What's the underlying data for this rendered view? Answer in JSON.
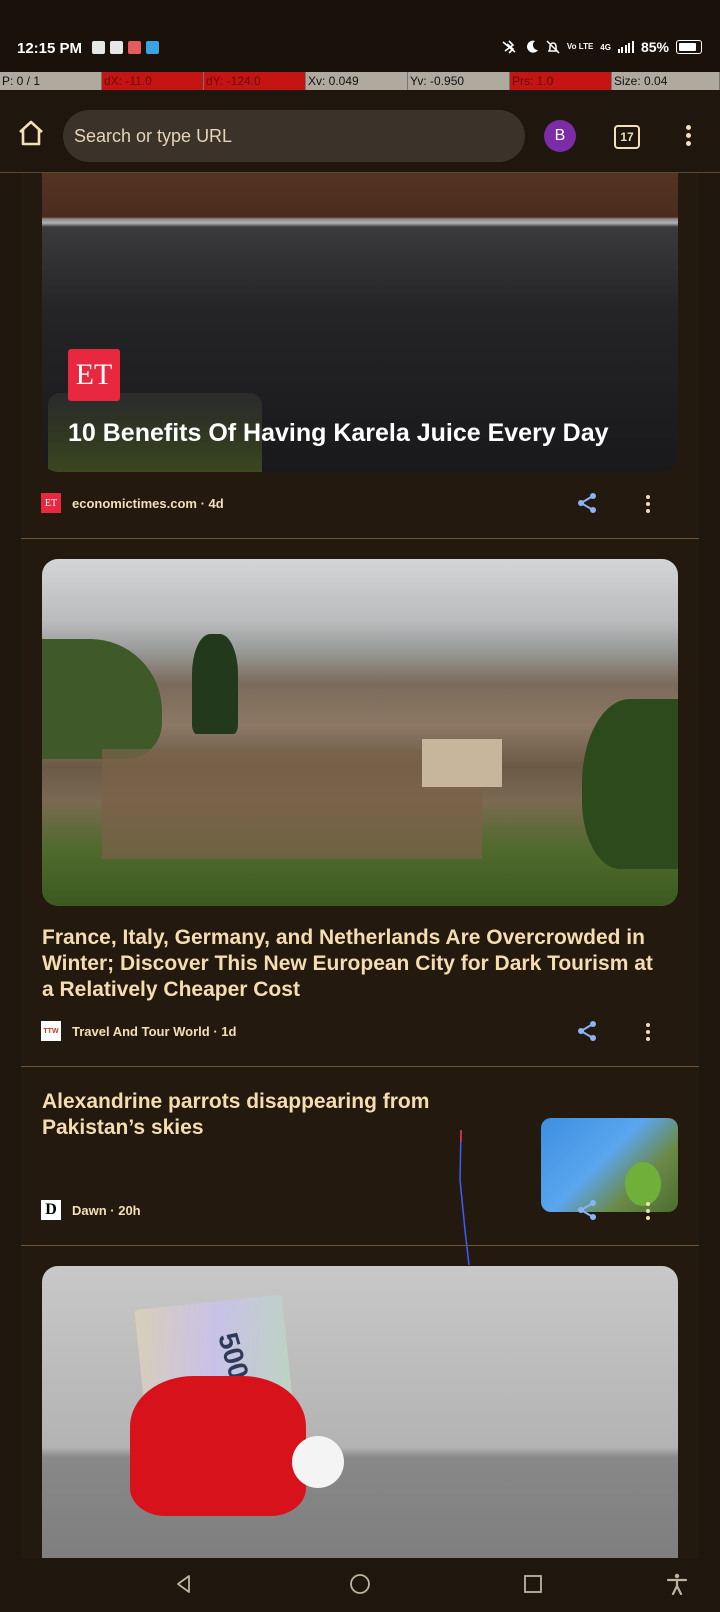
{
  "status_bar": {
    "time": "12:15 PM",
    "battery_percent": "85%",
    "network": "4G",
    "volte": "Vo LTE"
  },
  "debug_bar": {
    "cells": [
      "P: 0 / 1",
      "dX: -11.0",
      "dY: -124.0",
      "Xv: 0.049",
      "Yv: -0.950",
      "Prs: 1.0",
      "Size: 0.04"
    ]
  },
  "toolbar": {
    "url_placeholder": "Search or type URL",
    "avatar_letter": "B",
    "tab_count": "17"
  },
  "feed": {
    "articles": [
      {
        "headline": "10 Benefits Of Having Karela Juice Every Day",
        "logo_text": "ET",
        "favicon_text": "ET",
        "source": "economictimes.com · 4d"
      },
      {
        "headline": "France, Italy, Germany, and Netherlands Are Overcrowded in Winter; Discover This New European City for Dark Tourism at a Relatively Cheaper Cost",
        "favicon_text": "TTW",
        "source": "Travel And Tour World · 1d"
      },
      {
        "headline": "Alexandrine parrots disappearing from Pakistan’s skies",
        "favicon_text": "D",
        "source": "Dawn · 20h"
      },
      {
        "headline": "",
        "banknote_text": "500"
      }
    ]
  },
  "colors": {
    "background": "#1f160d",
    "text": "#f3dfb8",
    "avatar": "#7c2ca5",
    "share_icon": "#8ab4f8"
  }
}
